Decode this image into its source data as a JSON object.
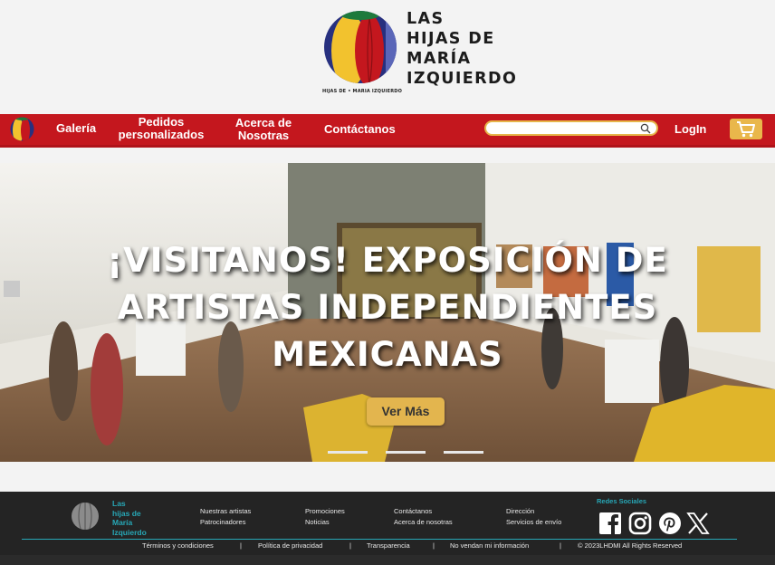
{
  "brand": {
    "name_lines": [
      "LAS",
      "HIJAS DE",
      "MARÍA",
      "IZQUIERDO"
    ],
    "small_tag": "HIJAS DE •  MARIA IZQUIERDO",
    "colors": {
      "red": "#c4171e",
      "yellow": "#f2c22e",
      "blue": "#27307f",
      "green": "#1e7a3c",
      "gold": "#e3b54e",
      "teal": "#27a7b6"
    }
  },
  "nav": {
    "items": [
      {
        "label_lines": [
          "Galería"
        ]
      },
      {
        "label_lines": [
          "Pedidos",
          "personalizados"
        ]
      },
      {
        "label_lines": [
          "Acerca de",
          "Nosotras"
        ]
      },
      {
        "label_lines": [
          "Contáctanos"
        ]
      }
    ],
    "search": {
      "value": "",
      "placeholder": "",
      "icon": "search-icon"
    },
    "login_label": "LogIn",
    "cart_icon": "cart-icon"
  },
  "hero": {
    "title_lines": [
      "¡VISITANOS! EXPOSICIÓN DE",
      "ARTISTAS INDEPENDIENTES",
      "MEXICANAS"
    ],
    "button_label": "Ver Más",
    "carousel_slides": 3
  },
  "footer": {
    "brand_lines": [
      "Las",
      "hijas de",
      "María",
      "Izquierdo"
    ],
    "columns": [
      [
        "Nuestras artistas",
        "Patrocinadores"
      ],
      [
        "Promociones",
        "Noticias"
      ],
      [
        "Contáctanos",
        "Acerca de nosotras"
      ],
      [
        "Dirección",
        "Servicios de envío"
      ]
    ],
    "social_title": "Redes Sociales",
    "social_icons": [
      "facebook-icon",
      "instagram-icon",
      "pinterest-icon",
      "x-icon"
    ],
    "legal": [
      "Términos y condiciones",
      "|",
      "Política de privacidad",
      "|",
      "Transparencia",
      "|",
      "No vendan mi información",
      "|",
      "© 2023LHDMI All Rights Reserved"
    ]
  }
}
